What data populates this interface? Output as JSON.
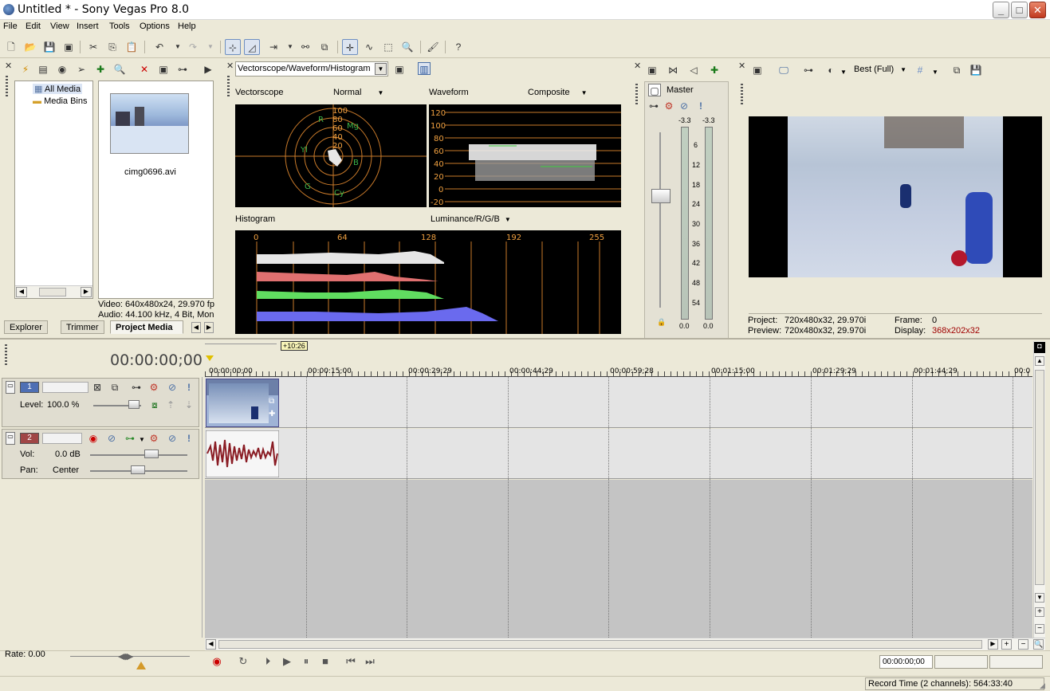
{
  "window": {
    "title": "Untitled * - Sony Vegas Pro 8.0",
    "minimize": "_",
    "maximize": "□",
    "close": "✕"
  },
  "menu": [
    "File",
    "Edit",
    "View",
    "Insert",
    "Tools",
    "Options",
    "Help"
  ],
  "explorer": {
    "tree": [
      "All Media",
      "Media Bins"
    ],
    "media_file": "cimg0696.avi",
    "video_info": "Video: 640x480x24, 29.970 fp",
    "audio_info": "Audio: 44.100 kHz, 4 Bit, Mon",
    "tabs": [
      "Explorer",
      "Trimmer",
      "Project Media"
    ]
  },
  "scopes": {
    "selector": "Vectorscope/Waveform/Histogram",
    "vectorscope": {
      "title": "Vectorscope",
      "mode": "Normal",
      "rings": [
        "100",
        "80",
        "60",
        "40",
        "20"
      ],
      "markers": [
        "R",
        "Mg",
        "B",
        "Cy",
        "G",
        "Yl"
      ]
    },
    "waveform": {
      "title": "Waveform",
      "mode": "Composite",
      "ticks": [
        "120",
        "100",
        "80",
        "60",
        "40",
        "20",
        "0",
        "-20"
      ]
    },
    "histogram": {
      "title": "Histogram",
      "mode": "Luminance/R/G/B",
      "ticks": [
        "0",
        "64",
        "128",
        "192",
        "255"
      ]
    }
  },
  "master": {
    "label": "Master",
    "peak_left": "-3.3",
    "peak_right": "-3.3",
    "scale": [
      "6",
      "12",
      "18",
      "24",
      "30",
      "36",
      "42",
      "48",
      "54"
    ],
    "value_left": "0.0",
    "value_right": "0.0"
  },
  "preview": {
    "quality": "Best (Full)",
    "project_label": "Project:",
    "project_value": "720x480x32, 29.970i",
    "preview_label": "Preview:",
    "preview_value": "720x480x32, 29.970i",
    "frame_label": "Frame:",
    "frame_value": "0",
    "display_label": "Display:",
    "display_value": "368x202x32",
    "display_color": "#a00000"
  },
  "timeline": {
    "timecode": "00:00:00;00",
    "region_marker": "+10:26",
    "ruler": [
      "00:00:00;00",
      "00:00:15;00",
      "00:00:29;29",
      "00:00:44;29",
      "00:00:59;28",
      "00:01:15;00",
      "00:01:29;29",
      "00:01:44;29",
      "00:0"
    ],
    "tracks": [
      {
        "number": "1",
        "type": "video",
        "level_label": "Level:",
        "level_value": "100.0 %",
        "level_fraction": 1.0
      },
      {
        "number": "2",
        "type": "audio",
        "vol_label": "Vol:",
        "vol_value": "0.0 dB",
        "pan_label": "Pan:",
        "pan_value": "Center"
      }
    ]
  },
  "transport": {
    "rate_label": "Rate: 0.00",
    "time_field": "00:00:00;00"
  },
  "status": {
    "record_time": "Record Time (2 channels): 564:33:40"
  }
}
